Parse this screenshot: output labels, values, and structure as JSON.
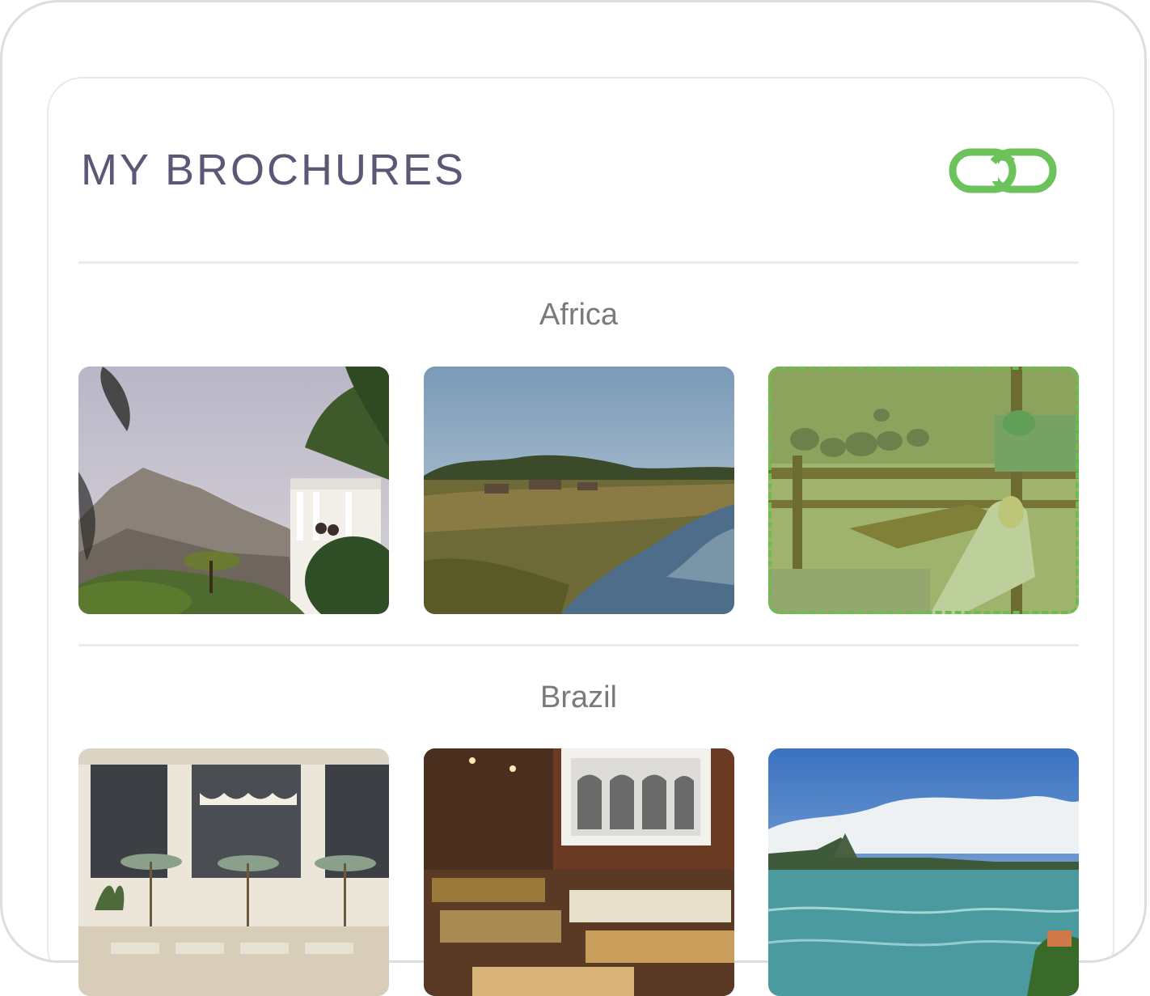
{
  "header": {
    "title": "MY BROCHURES",
    "link_icon": "link-icon",
    "accent_color": "#6cc35b"
  },
  "sections": [
    {
      "title": "Africa",
      "photos": [
        {
          "subject": "mountain and palm terrace",
          "selected": false
        },
        {
          "subject": "river safari landscape",
          "selected": false
        },
        {
          "subject": "elephant view deck",
          "selected": true
        }
      ]
    },
    {
      "title": "Brazil",
      "photos": [
        {
          "subject": "hotel pool terrace",
          "selected": false
        },
        {
          "subject": "buffet restaurant",
          "selected": false
        },
        {
          "subject": "bay coastline",
          "selected": false
        }
      ]
    }
  ]
}
